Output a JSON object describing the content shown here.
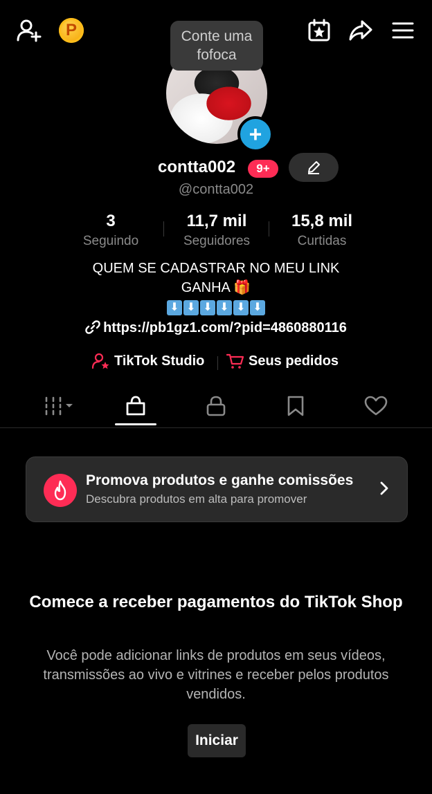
{
  "tooltip": {
    "text_line1": "Conte uma",
    "text_line2": "fofoca"
  },
  "top_bar": {
    "coin_letter": "P",
    "icons": [
      "add-friend-icon",
      "coin-icon",
      "calendar-star-icon",
      "share-icon",
      "menu-icon"
    ]
  },
  "profile": {
    "username": "contta002",
    "notification_badge": "9+",
    "handle": "@contta002"
  },
  "stats": [
    {
      "value": "3",
      "label": "Seguindo"
    },
    {
      "value": "11,7 mil",
      "label": "Seguidores"
    },
    {
      "value": "15,8 mil",
      "label": "Curtidas"
    }
  ],
  "bio": {
    "line1": "QUEM SE CADASTRAR NO MEU LINK",
    "line2": "GANHA 🎁",
    "arrows": "⬇⬇⬇⬇⬇⬇",
    "link": "https://pb1gz1.com/?pid=4860880116"
  },
  "quick_links": {
    "studio": "TikTok Studio",
    "orders": "Seus pedidos"
  },
  "tabs": [
    "videos-grid-icon",
    "shop-bag-icon",
    "lock-icon",
    "bookmark-icon",
    "heart-icon"
  ],
  "promo": {
    "title": "Promova produtos e ganhe comissões",
    "subtitle": "Descubra produtos em alta para promover"
  },
  "cta": {
    "title": "Comece a receber pagamentos do TikTok Shop",
    "description": "Você pode adicionar links de produtos em seus vídeos, transmissões ao vivo e vitrines e receber pelos produtos vendidos.",
    "button": "Iniciar"
  },
  "colors": {
    "accent": "#fe2c55",
    "blue": "#20a3e0",
    "gold": "#f4a100"
  }
}
